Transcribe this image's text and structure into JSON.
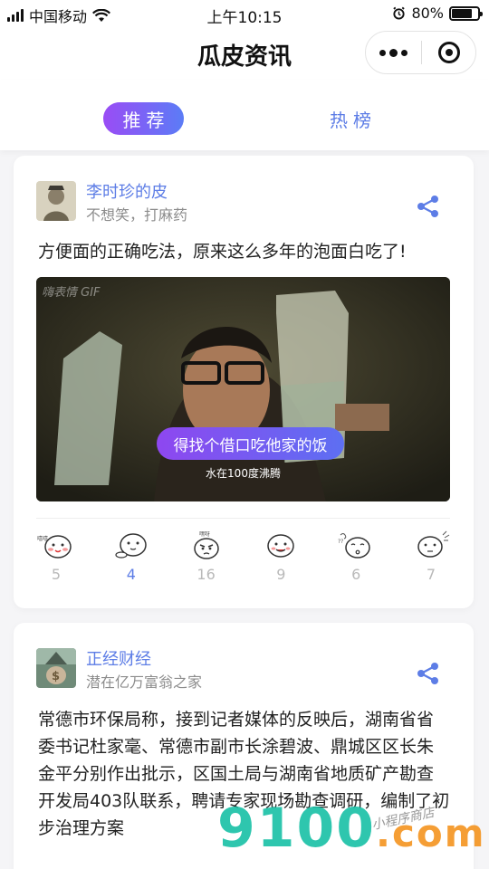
{
  "status_bar": {
    "carrier": "中国移动",
    "time": "上午10:15",
    "battery": "80%",
    "battery_level": 0.8
  },
  "nav": {
    "title": "瓜皮资讯"
  },
  "tabs": [
    {
      "label": "推荐",
      "active": true
    },
    {
      "label": "热榜",
      "active": false
    }
  ],
  "feed": [
    {
      "author": "李时珍的皮",
      "subtitle": "不想笑，打麻药",
      "text": "方便面的正确吃法，原来这么多年的泡面白吃了!",
      "media": {
        "watermark": "嗨表情 GIF",
        "caption": "得找个借口吃他家的饭",
        "subcaption": "水在100度沸腾"
      },
      "reactions": [
        {
          "icon": "blushing-face-icon",
          "count": "5"
        },
        {
          "icon": "waving-face-icon",
          "count": "4",
          "active": true
        },
        {
          "icon": "angry-face-icon",
          "count": "16"
        },
        {
          "icon": "tongue-out-face-icon",
          "count": "9"
        },
        {
          "icon": "dizzy-face-icon",
          "count": "6"
        },
        {
          "icon": "sweat-face-icon",
          "count": "7"
        }
      ]
    },
    {
      "author": "正经财经",
      "subtitle": "潜在亿万富翁之家",
      "text": "常德市环保局称，接到记者媒体的反映后，湖南省省委书记杜家毫、常德市副市长涂碧波、鼎城区区长朱金平分别作出批示，区国土局与湖南省地质矿产勘查开发局403队联系，聘请专家现场勘查调研，编制了初步治理方案"
    }
  ],
  "watermark": {
    "site": "9100",
    "suffix": ".com",
    "note": "小程序商店"
  },
  "colors": {
    "accent": "#5d7de6",
    "tab_gradient_start": "#9a4cf5",
    "tab_gradient_end": "#5b7cf6"
  }
}
